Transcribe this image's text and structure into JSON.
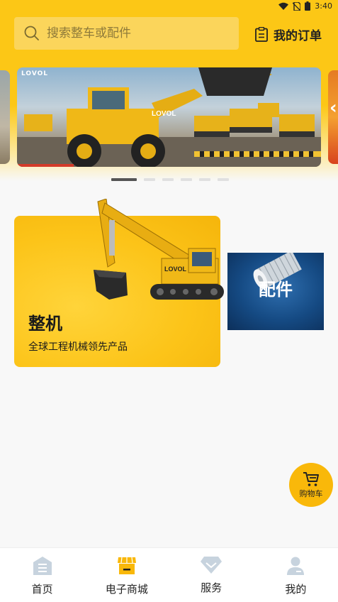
{
  "status_bar": {
    "time": "3:40",
    "icons": [
      "wifi-icon",
      "no-sim-icon",
      "battery-icon"
    ]
  },
  "search": {
    "placeholder": "搜索整车或配件"
  },
  "header": {
    "orders_label": "我的订单"
  },
  "banner": {
    "brand": "LOVOL",
    "slide_count": 6,
    "active_index": 0
  },
  "categories": [
    {
      "title": "整机",
      "subtitle": "全球工程机械领先产品"
    },
    {
      "title": "配件"
    }
  ],
  "cart": {
    "label": "购物车"
  },
  "nav": [
    {
      "label": "首页",
      "icon": "home-icon"
    },
    {
      "label": "电子商城",
      "icon": "shop-icon",
      "active": true
    },
    {
      "label": "服务",
      "icon": "diamond-icon"
    },
    {
      "label": "我的",
      "icon": "profile-icon"
    }
  ],
  "colors": {
    "brand_yellow": "#fcc716",
    "active_icon": "#f9b80a",
    "inactive_icon": "#c7d3de"
  }
}
